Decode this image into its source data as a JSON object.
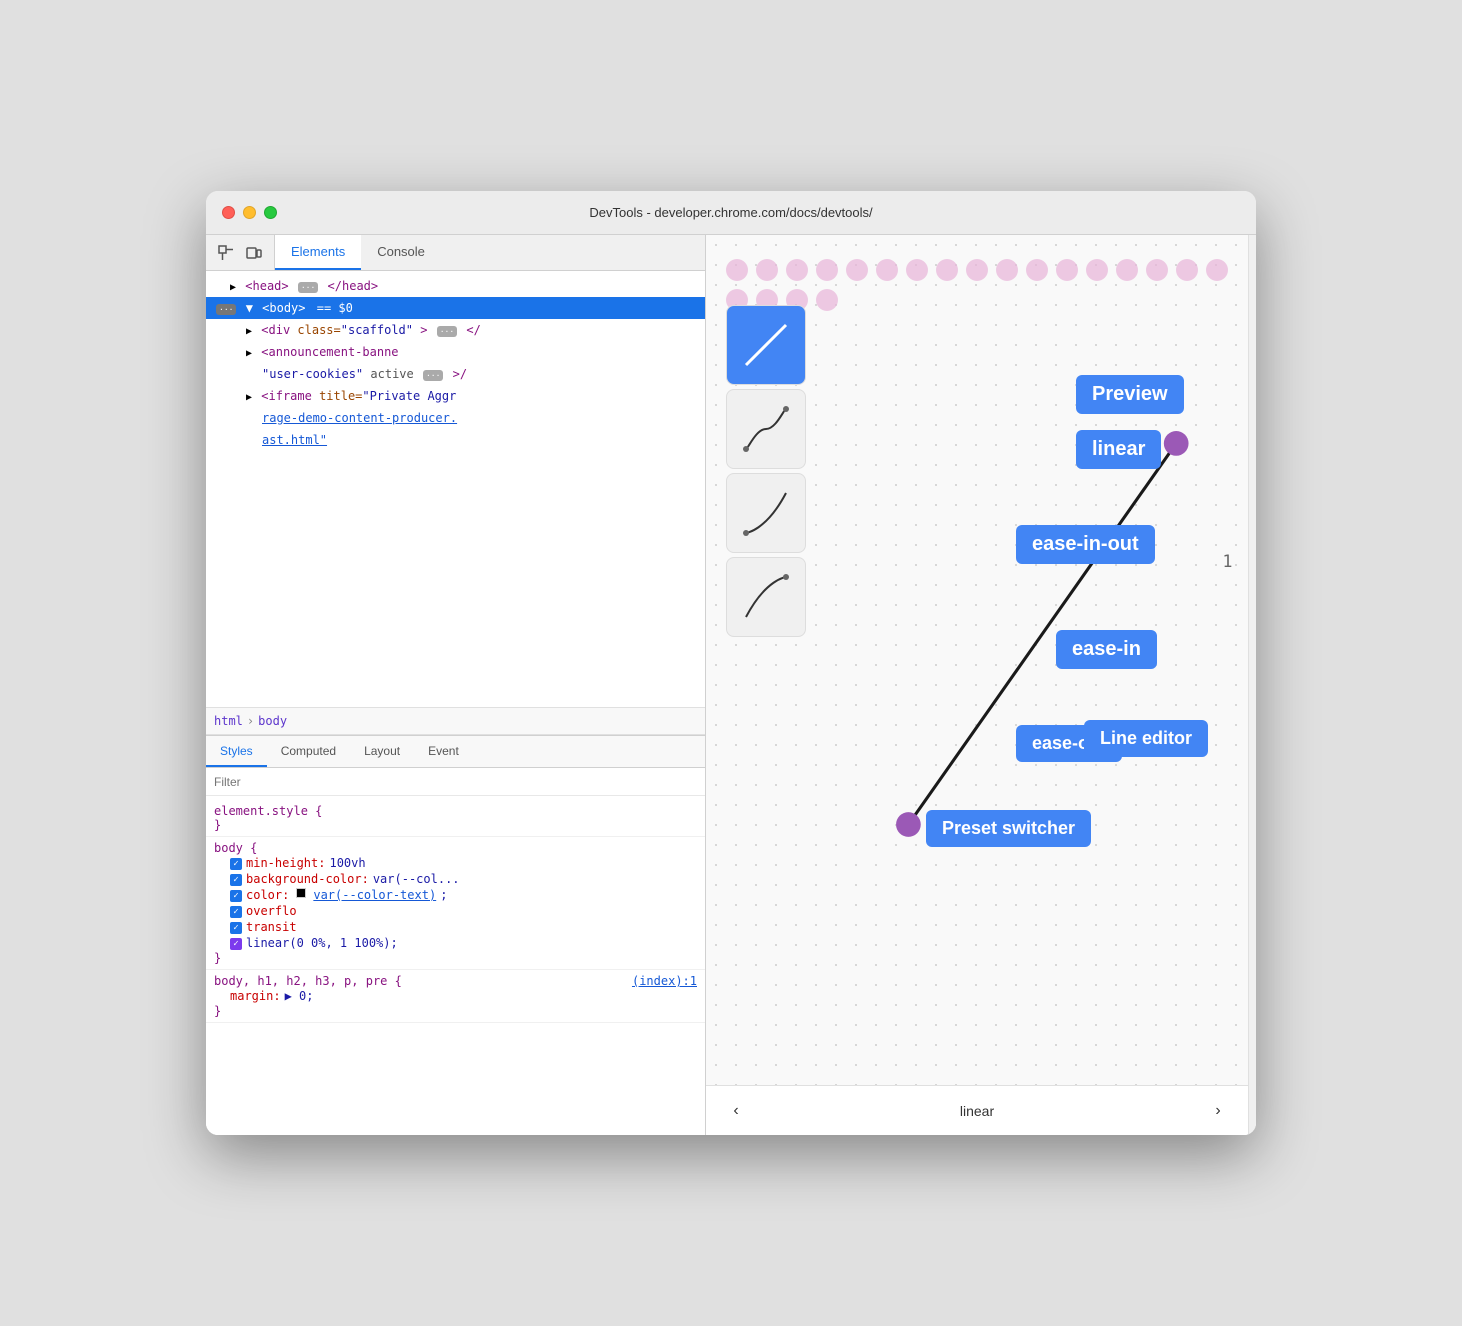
{
  "window": {
    "title": "DevTools - developer.chrome.com/docs/devtools/"
  },
  "tabs": {
    "main": [
      "Elements",
      "Console"
    ],
    "active_main": "Elements",
    "styles": [
      "Styles",
      "Computed",
      "Layout",
      "Event"
    ],
    "active_styles": "Styles"
  },
  "elements_panel": {
    "lines": [
      {
        "indent": 1,
        "content": "<head> ··· </head>"
      },
      {
        "indent": 0,
        "content": "··· ▼ <body> == $0",
        "selected": true
      },
      {
        "indent": 2,
        "content": "▶ <div class=\"scaffold\"> ··· </\\"
      },
      {
        "indent": 2,
        "content": "▶ <announcement-banne"
      },
      {
        "indent": 3,
        "content": "\"user-cookies\" active ··· >/\\"
      },
      {
        "indent": 2,
        "content": "▶ <iframe title=\"Private Aggr"
      },
      {
        "indent": 3,
        "content": "rage-demo-content-producer."
      },
      {
        "indent": 3,
        "content": "ast.html\""
      }
    ]
  },
  "breadcrumb": {
    "items": [
      "html",
      "body"
    ]
  },
  "filter": {
    "placeholder": "Filter"
  },
  "styles_content": {
    "rules": [
      {
        "selector": "element.style {",
        "close": "}",
        "props": []
      },
      {
        "selector": "body {",
        "close": "}",
        "props": [
          {
            "name": "min-height:",
            "value": "100vh",
            "checked": true
          },
          {
            "name": "background-color:",
            "value": "var(--col...",
            "checked": true
          },
          {
            "name": "color:",
            "value": "var(--color-text);",
            "checked": true,
            "swatch": "#000"
          },
          {
            "name": "overflo",
            "value": "",
            "checked": true
          },
          {
            "name": "transit",
            "value": "",
            "checked": true
          },
          {
            "name": "linear(0 0%, 1 100%);",
            "value": "",
            "checked": true,
            "purple": true
          }
        ]
      },
      {
        "selector": "body, h1, h2, h3, p, pre {",
        "close": "}",
        "source": "(index):1",
        "props": [
          {
            "name": "margin:",
            "value": "▶ 0;"
          }
        ]
      }
    ]
  },
  "preview": {
    "presets": [
      {
        "name": "linear",
        "type": "diagonal"
      },
      {
        "name": "ease-in-out",
        "type": "ease-in-out"
      },
      {
        "name": "ease-in",
        "type": "ease-in"
      },
      {
        "name": "ease-out",
        "type": "ease-out"
      }
    ],
    "callouts": {
      "preview": "Preview",
      "linear": "linear",
      "ease_in_out": "ease-in-out",
      "ease_in": "ease-in",
      "ease_out": "ease-out",
      "preset_switcher": "Preset switcher",
      "line_editor": "Line editor"
    },
    "footer": {
      "prev_label": "‹",
      "next_label": "›",
      "current": "linear"
    }
  }
}
